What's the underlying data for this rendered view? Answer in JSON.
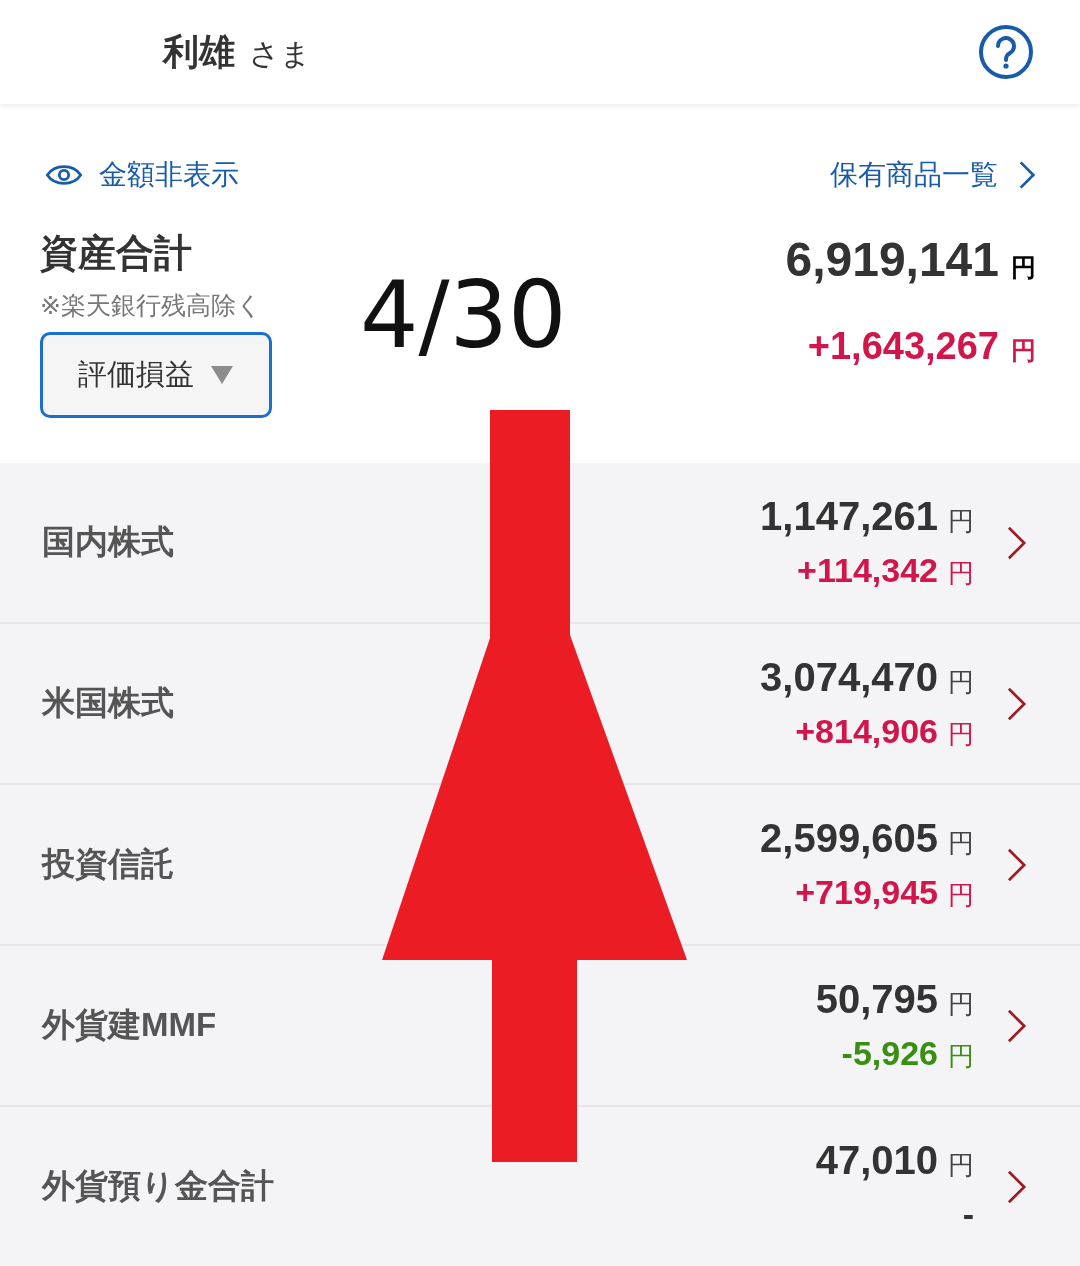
{
  "header": {
    "name": "利雄",
    "honorific": "さま"
  },
  "hide_amounts": {
    "label": "金額非表示"
  },
  "holdings_link": {
    "label": "保有商品一覧"
  },
  "total": {
    "title": "資産合計",
    "note": "※楽天銀行残高除く",
    "dropdown": {
      "value": "評価損益"
    },
    "amount": "6,919,141",
    "unit": "円",
    "gain": {
      "value": "+1,643,267",
      "unit": "円",
      "color": "#d1164b"
    }
  },
  "annotation": {
    "date": "4/30"
  },
  "categories": [
    {
      "name": "国内株式",
      "amount": "1,147,261",
      "unit": "円",
      "gain": {
        "value": "+114,342",
        "unit": "円",
        "color": "#d1164b"
      }
    },
    {
      "name": "米国株式",
      "amount": "3,074,470",
      "unit": "円",
      "gain": {
        "value": "+814,906",
        "unit": "円",
        "color": "#d1164b"
      }
    },
    {
      "name": "投資信託",
      "amount": "2,599,605",
      "unit": "円",
      "gain": {
        "value": "+719,945",
        "unit": "円",
        "color": "#d1164b"
      }
    },
    {
      "name": "外貨建MMF",
      "amount": "50,795",
      "unit": "円",
      "gain": {
        "value": "-5,926",
        "unit": "円",
        "color": "#3a8f12"
      }
    },
    {
      "name": "外貨預り金合計",
      "amount": "47,010",
      "unit": "円",
      "gain": {
        "value": "-",
        "color": "#333333"
      }
    }
  ]
}
